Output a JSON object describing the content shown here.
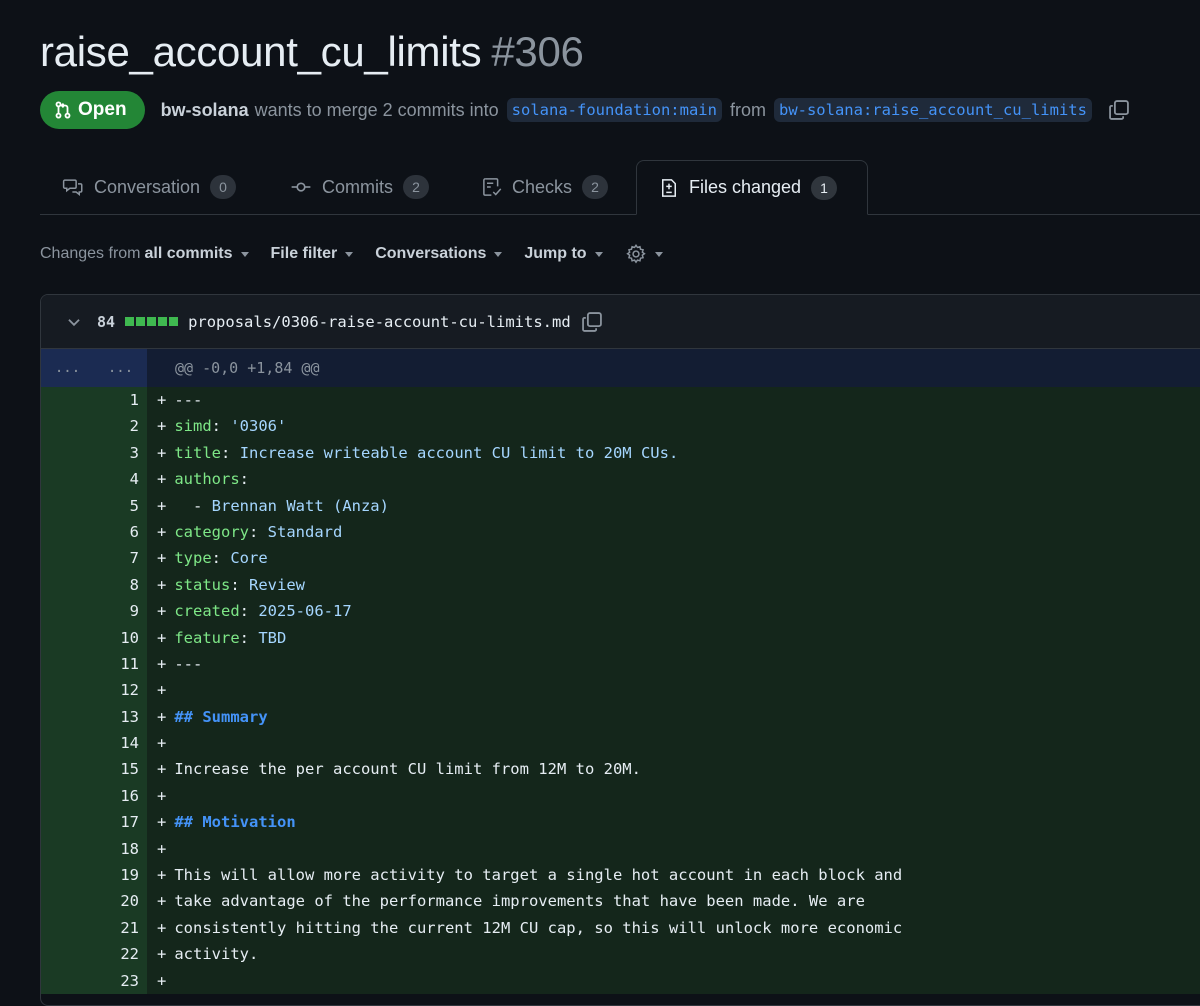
{
  "pr": {
    "title": "raise_account_cu_limits",
    "number": "#306",
    "state": "Open",
    "author": "bw-solana",
    "merge_text": "wants to merge 2 commits into",
    "base_branch": "solana-foundation:main",
    "from_text": "from",
    "head_branch": "bw-solana:raise_account_cu_limits"
  },
  "tabs": [
    {
      "label": "Conversation",
      "count": "0"
    },
    {
      "label": "Commits",
      "count": "2"
    },
    {
      "label": "Checks",
      "count": "2"
    },
    {
      "label": "Files changed",
      "count": "1"
    }
  ],
  "toolbar": {
    "changes_prefix": "Changes from",
    "changes_value": "all commits",
    "file_filter": "File filter",
    "conversations": "Conversations",
    "jump_to": "Jump to"
  },
  "file": {
    "diffstat": "84",
    "path": "proposals/0306-raise-account-cu-limits.md",
    "hunk_gutter_old": "...",
    "hunk_gutter_new": "...",
    "hunk_header": "@@ -0,0 +1,84 @@"
  },
  "diff_lines": [
    {
      "n": "1",
      "parts": [
        [
          "t",
          "---"
        ]
      ]
    },
    {
      "n": "2",
      "parts": [
        [
          "k",
          "simd"
        ],
        [
          "t",
          ": "
        ],
        [
          "v",
          "'0306'"
        ]
      ]
    },
    {
      "n": "3",
      "parts": [
        [
          "k",
          "title"
        ],
        [
          "t",
          ": "
        ],
        [
          "v",
          "Increase writeable account CU limit to 20M CUs."
        ]
      ]
    },
    {
      "n": "4",
      "parts": [
        [
          "k",
          "authors"
        ],
        [
          "t",
          ":"
        ]
      ]
    },
    {
      "n": "5",
      "parts": [
        [
          "t",
          "  - "
        ],
        [
          "v",
          "Brennan Watt (Anza)"
        ]
      ]
    },
    {
      "n": "6",
      "parts": [
        [
          "k",
          "category"
        ],
        [
          "t",
          ": "
        ],
        [
          "v",
          "Standard"
        ]
      ]
    },
    {
      "n": "7",
      "parts": [
        [
          "k",
          "type"
        ],
        [
          "t",
          ": "
        ],
        [
          "v",
          "Core"
        ]
      ]
    },
    {
      "n": "8",
      "parts": [
        [
          "k",
          "status"
        ],
        [
          "t",
          ": "
        ],
        [
          "v",
          "Review"
        ]
      ]
    },
    {
      "n": "9",
      "parts": [
        [
          "k",
          "created"
        ],
        [
          "t",
          ": "
        ],
        [
          "b",
          "2025-06-17"
        ]
      ]
    },
    {
      "n": "10",
      "parts": [
        [
          "k",
          "feature"
        ],
        [
          "t",
          ": "
        ],
        [
          "v",
          "TBD"
        ]
      ]
    },
    {
      "n": "11",
      "parts": [
        [
          "t",
          "---"
        ]
      ]
    },
    {
      "n": "12",
      "parts": []
    },
    {
      "n": "13",
      "parts": [
        [
          "h",
          "## Summary"
        ]
      ]
    },
    {
      "n": "14",
      "parts": []
    },
    {
      "n": "15",
      "parts": [
        [
          "t",
          "Increase the per account CU limit from 12M to 20M."
        ]
      ]
    },
    {
      "n": "16",
      "parts": []
    },
    {
      "n": "17",
      "parts": [
        [
          "h",
          "## Motivation"
        ]
      ]
    },
    {
      "n": "18",
      "parts": []
    },
    {
      "n": "19",
      "parts": [
        [
          "t",
          "This will allow more activity to target a single hot account in each block and"
        ]
      ]
    },
    {
      "n": "20",
      "parts": [
        [
          "t",
          "take advantage of the performance improvements that have been made. We are"
        ]
      ]
    },
    {
      "n": "21",
      "parts": [
        [
          "t",
          "consistently hitting the current 12M CU cap, so this will unlock more economic"
        ]
      ]
    },
    {
      "n": "22",
      "parts": [
        [
          "t",
          "activity."
        ]
      ]
    },
    {
      "n": "23",
      "parts": []
    }
  ]
}
